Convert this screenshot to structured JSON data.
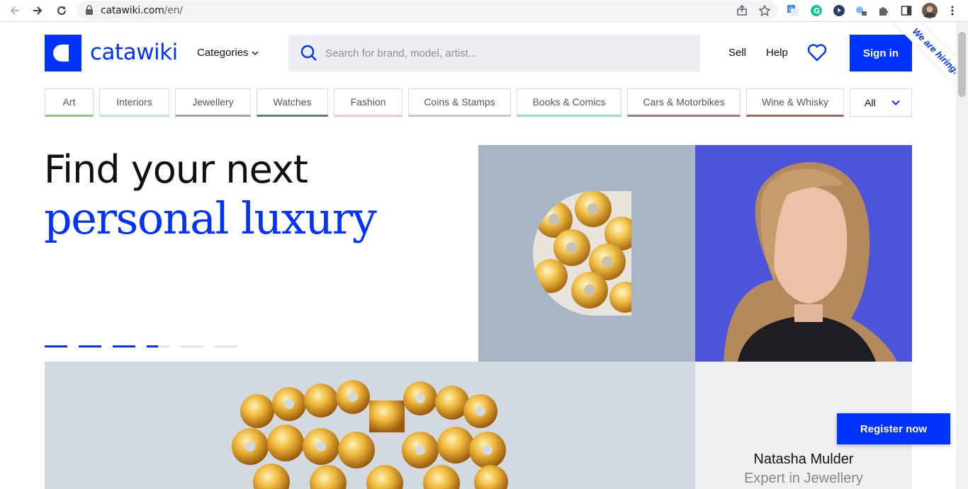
{
  "browser": {
    "url_host": "catawiki.com",
    "url_path": "/en/"
  },
  "header": {
    "logo_text": "catawiki",
    "categories_label": "Categories",
    "search_placeholder": "Search for brand, model, artist...",
    "sell_label": "Sell",
    "help_label": "Help",
    "signin_label": "Sign in",
    "hiring_label": "We are hiring!"
  },
  "tabs": [
    {
      "label": "Art",
      "color": "#9bc47a"
    },
    {
      "label": "Interiors",
      "color": "#bfe3ea"
    },
    {
      "label": "Jewellery",
      "color": "#9aa8ae"
    },
    {
      "label": "Watches",
      "color": "#5f7d7d"
    },
    {
      "label": "Fashion",
      "color": "#f3c7cf"
    },
    {
      "label": "Coins & Stamps",
      "color": "#c9c6d3"
    },
    {
      "label": "Books & Comics",
      "color": "#97dcd3"
    },
    {
      "label": "Cars & Motorbikes",
      "color": "#9b8079"
    },
    {
      "label": "Wine & Whisky",
      "color": "#a9625e"
    }
  ],
  "tab_all_label": "All",
  "hero": {
    "line1": "Find your next",
    "line2": "personal luxury",
    "carousel": [
      1,
      1,
      1,
      0.5,
      0,
      0
    ]
  },
  "expert": {
    "name": "Natasha Mulder",
    "role": "Expert in Jewellery"
  },
  "register_label": "Register now",
  "colors": {
    "brand_blue": "#0033ff"
  }
}
